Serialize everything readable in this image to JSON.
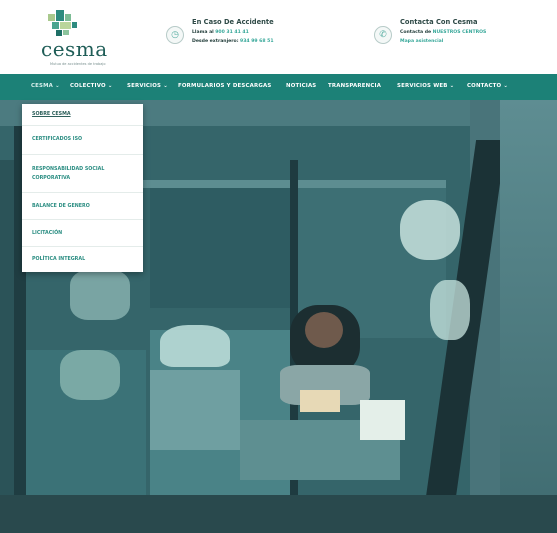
{
  "header": {
    "logo": {
      "text": "cesma",
      "subtitle": "Mutua de accidentes de trabajo"
    },
    "accident": {
      "title": "En Caso De Accidente",
      "line1_label": "Llama al",
      "line1_value": "900 31 41 41",
      "line2_label": "Desde extranjero:",
      "line2_value": "934 99 68 51"
    },
    "contact": {
      "title": "Contacta Con Cesma",
      "line1_label": "Contacta de",
      "line1_value": "NUESTROS CENTROS",
      "line2_value": "Mapa asistencial"
    }
  },
  "nav": {
    "items": [
      "CESMA",
      "COLECTIVO",
      "SERVICIOS",
      "FORMULARIOS Y DESCARGAS",
      "NOTICIAS",
      "TRANSPARENCIA",
      "SERVICIOS WEB",
      "CONTACTO"
    ],
    "chevron": "⌄"
  },
  "dropdown": {
    "items": [
      [
        "SOBRE CESMA"
      ],
      [
        "CERTIFICADOS ISO"
      ],
      [
        "RESPONSABILIDAD SOCIAL",
        "CORPORATIVA"
      ],
      [
        "BALANCE DE GENERO"
      ],
      [
        "LICITACIÓN"
      ],
      [
        "POLÍTICA INTEGRAL"
      ]
    ]
  },
  "colors": {
    "nav_bg": "#1c8177",
    "accent": "#38a89a",
    "hero_bg": "#35656a"
  },
  "icons": {
    "accident": "clock-icon",
    "contact": "phone-icon"
  }
}
